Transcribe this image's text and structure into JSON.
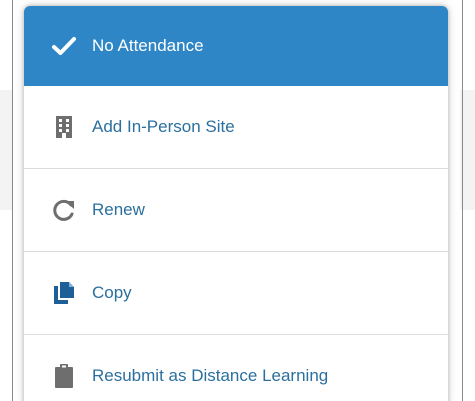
{
  "menu": {
    "items": [
      {
        "label": "No Attendance",
        "icon": "checkmark-icon",
        "selected": true
      },
      {
        "label": "Add In-Person Site",
        "icon": "building-icon",
        "selected": false
      },
      {
        "label": "Renew",
        "icon": "redo-icon",
        "selected": false
      },
      {
        "label": "Copy",
        "icon": "copy-icon",
        "selected": false
      },
      {
        "label": "Resubmit as Distance Learning",
        "icon": "clipboard-icon",
        "selected": false
      }
    ]
  },
  "colors": {
    "selected_bg": "#2f86c7",
    "selected_text": "#ffffff",
    "item_text": "#2a6f9e",
    "icon_gray": "#6e6e6e",
    "icon_blue": "#1f5f97"
  }
}
